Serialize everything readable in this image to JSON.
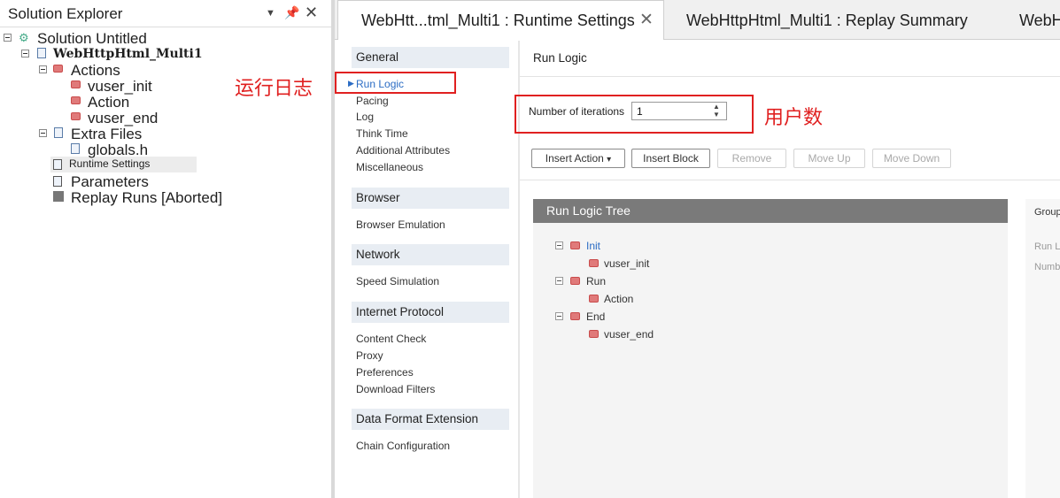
{
  "solution_explorer": {
    "title": "Solution Explorer",
    "items": {
      "solution": "Solution Untitled",
      "script": "WebHttpHtml_Multi1",
      "actions": "Actions",
      "vuser_init": "vuser_init",
      "action": "Action",
      "vuser_end": "vuser_end",
      "extra_files": "Extra Files",
      "globals": "globals.h",
      "runtime_settings": "Runtime Settings",
      "parameters": "Parameters",
      "replay_runs": "Replay Runs [Aborted]"
    }
  },
  "tabs": [
    {
      "label": "WebHtt...tml_Multi1 : Runtime Settings"
    },
    {
      "label": "WebHttpHtml_Multi1 : Replay Summary"
    },
    {
      "label": "WebH"
    }
  ],
  "nav": {
    "general": {
      "title": "General",
      "items": [
        "Run Logic",
        "Pacing",
        "Log",
        "Think Time",
        "Additional Attributes",
        "Miscellaneous"
      ]
    },
    "browser": {
      "title": "Browser",
      "items": [
        "Browser Emulation"
      ]
    },
    "network": {
      "title": "Network",
      "items": [
        "Speed Simulation"
      ]
    },
    "internet_protocol": {
      "title": "Internet Protocol",
      "items": [
        "Content Check",
        "Proxy",
        "Preferences",
        "Download Filters"
      ]
    },
    "data_format": {
      "title": "Data Format Extension",
      "items": [
        "Chain Configuration"
      ]
    }
  },
  "content": {
    "heading": "Run Logic",
    "iterations_label": "Number of iterations",
    "iterations_value": "1",
    "buttons": {
      "insert_action": "Insert Action",
      "insert_block": "Insert Block",
      "remove": "Remove",
      "move_up": "Move Up",
      "move_down": "Move Down"
    },
    "tree_title": "Run Logic Tree",
    "tree": {
      "init": "Init",
      "vuser_init": "vuser_init",
      "run": "Run",
      "action": "Action",
      "end": "End",
      "vuser_end": "vuser_end"
    },
    "right_panel": {
      "group": "Group",
      "run": "Run L",
      "number": "Numb"
    }
  },
  "annotations": {
    "run_log": "运行日志",
    "user_count": "用户数"
  },
  "colors": {
    "accent": "#2b6cc4",
    "annotation": "#e02020",
    "tree_header": "#7a7a7a"
  }
}
